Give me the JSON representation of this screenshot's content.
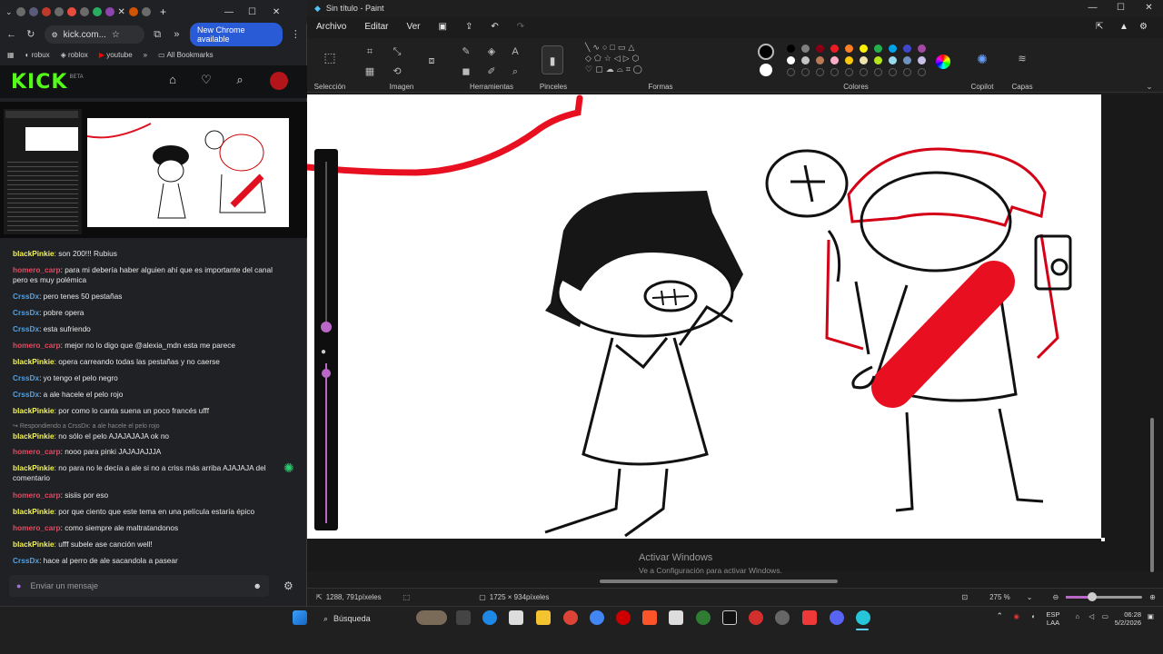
{
  "browser": {
    "address": "kick.com...",
    "update_label": "New Chrome available",
    "bookmarks": [
      "robux",
      "roblox",
      "youtube"
    ],
    "all_bookmarks": "All Bookmarks",
    "logo": "KICK",
    "logo_badge": "BETA"
  },
  "chat": {
    "messages": [
      {
        "user": "blackPinkie",
        "text": ": son 200!!! Rubius",
        "color": "u1"
      },
      {
        "user": "homero_carp",
        "text": ": para mi debería haber alguien ahí que es importante del canal pero es muy polémica",
        "color": "u2"
      },
      {
        "user": "CrssDx",
        "text": ": pero tenes 50 pestañas",
        "color": "u3"
      },
      {
        "user": "CrssDx",
        "text": ": pobre opera",
        "color": "u3"
      },
      {
        "user": "CrssDx",
        "text": ": esta sufriendo",
        "color": "u3"
      },
      {
        "user": "homero_carp",
        "text": ": mejor no lo digo que @alexia_mdn esta me parece",
        "color": "u2"
      },
      {
        "user": "blackPinkie",
        "text": ": opera carreando todas las pestañas y no caerse",
        "color": "u1"
      },
      {
        "user": "CrssDx",
        "text": ": yo tengo el pelo negro",
        "color": "u3"
      },
      {
        "user": "CrssDx",
        "text": ": a ale hacele el pelo rojo",
        "color": "u3"
      },
      {
        "user": "blackPinkie",
        "text": ": por como lo canta suena un poco francés ufff",
        "color": "u1"
      },
      {
        "user": "blackPinkie",
        "text": ": no sólo el pelo AJAJAJAJA ok no",
        "color": "u1"
      },
      {
        "user": "homero_carp",
        "text": ": nooo para pinki JAJAJAJJJA",
        "color": "u2"
      },
      {
        "user": "blackPinkie",
        "text": ": no para no le decía a ale si no a criss más arriba AJAJAJA del comentario",
        "color": "u1"
      },
      {
        "user": "homero_carp",
        "text": ": sisiis por eso",
        "color": "u2"
      },
      {
        "user": "blackPinkie",
        "text": ": por que ciento que este tema en una película estaría épico",
        "color": "u1"
      },
      {
        "user": "homero_carp",
        "text": ": como siempre ale maltratandonos",
        "color": "u2"
      },
      {
        "user": "blackPinkie",
        "text": ": ufff subele ase canción well!",
        "color": "u1"
      },
      {
        "user": "CrssDx",
        "text": ": hace al perro de ale sacandola a pasear",
        "color": "u3"
      }
    ],
    "reply_note": "Respondiendo a CrssDx: a ale hacele el pelo rojo",
    "input_placeholder": "Enviar un mensaje"
  },
  "paint": {
    "title": "Sin título - Paint",
    "menu": [
      "Archivo",
      "Editar",
      "Ver"
    ],
    "groups": [
      "Selección",
      "Imagen",
      "Herramientas",
      "Pinceles",
      "Formas",
      "Colores",
      "Copilot",
      "Capas"
    ],
    "palette_row1": [
      "#000000",
      "#7f7f7f",
      "#880015",
      "#ed1c24",
      "#ff7f27",
      "#fff200",
      "#22b14c",
      "#00a2e8",
      "#3f48cc",
      "#a349a4"
    ],
    "palette_row2": [
      "#ffffff",
      "#c3c3c3",
      "#b97a57",
      "#ffaec9",
      "#ffc90e",
      "#efe4b0",
      "#b5e61d",
      "#99d9ea",
      "#7092be",
      "#c8bfe7"
    ],
    "cursor_pos": "1288, 791píxeles",
    "canvas_size": "1725 × 934píxeles",
    "zoom": "275 %",
    "watermark_title": "Activar Windows",
    "watermark_sub": "Ve a Configuración para activar Windows."
  },
  "taskbar": {
    "search": "Búsqueda",
    "lang": "ESP",
    "lang2": "LAA",
    "time": "06:28",
    "date": "5/2/2026"
  }
}
